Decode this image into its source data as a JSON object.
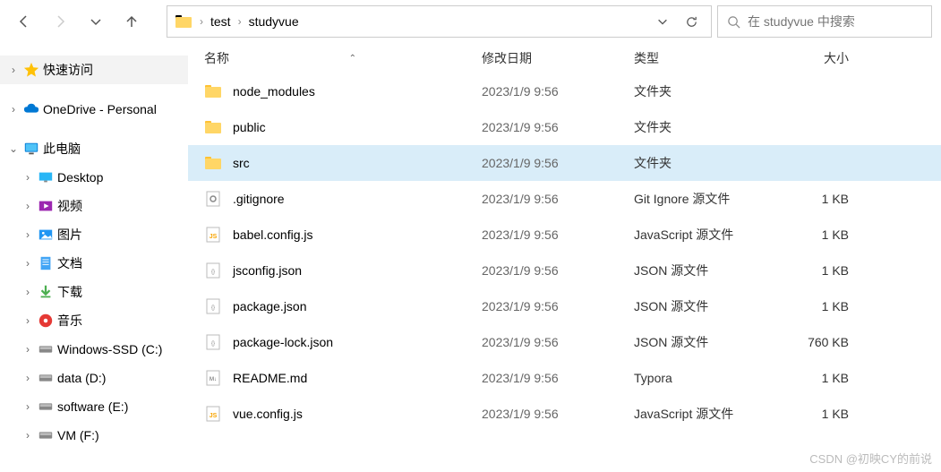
{
  "nav": {},
  "breadcrumb": {
    "parts": [
      "test",
      "studyvue"
    ]
  },
  "search": {
    "placeholder": "在 studyvue 中搜索"
  },
  "sidebar": {
    "quick_access": "快速访问",
    "onedrive": "OneDrive - Personal",
    "this_pc": "此电脑",
    "desktop": "Desktop",
    "videos": "视频",
    "pictures": "图片",
    "documents": "文档",
    "downloads": "下载",
    "music": "音乐",
    "win_ssd": "Windows-SSD (C:)",
    "data": "data (D:)",
    "software": "software (E:)",
    "vm": "VM (F:)"
  },
  "columns": {
    "name": "名称",
    "date": "修改日期",
    "type": "类型",
    "size": "大小"
  },
  "files": [
    {
      "name": "node_modules",
      "date": "2023/1/9 9:56",
      "type": "文件夹",
      "size": "",
      "icon": "folder",
      "selected": false
    },
    {
      "name": "public",
      "date": "2023/1/9 9:56",
      "type": "文件夹",
      "size": "",
      "icon": "folder",
      "selected": false
    },
    {
      "name": "src",
      "date": "2023/1/9 9:56",
      "type": "文件夹",
      "size": "",
      "icon": "folder",
      "selected": true
    },
    {
      "name": ".gitignore",
      "date": "2023/1/9 9:56",
      "type": "Git Ignore 源文件",
      "size": "1 KB",
      "icon": "gear",
      "selected": false
    },
    {
      "name": "babel.config.js",
      "date": "2023/1/9 9:56",
      "type": "JavaScript 源文件",
      "size": "1 KB",
      "icon": "js",
      "selected": false
    },
    {
      "name": "jsconfig.json",
      "date": "2023/1/9 9:56",
      "type": "JSON 源文件",
      "size": "1 KB",
      "icon": "json",
      "selected": false
    },
    {
      "name": "package.json",
      "date": "2023/1/9 9:56",
      "type": "JSON 源文件",
      "size": "1 KB",
      "icon": "json",
      "selected": false
    },
    {
      "name": "package-lock.json",
      "date": "2023/1/9 9:56",
      "type": "JSON 源文件",
      "size": "760 KB",
      "icon": "json",
      "selected": false
    },
    {
      "name": "README.md",
      "date": "2023/1/9 9:56",
      "type": "Typora",
      "size": "1 KB",
      "icon": "md",
      "selected": false
    },
    {
      "name": "vue.config.js",
      "date": "2023/1/9 9:56",
      "type": "JavaScript 源文件",
      "size": "1 KB",
      "icon": "js",
      "selected": false
    }
  ],
  "watermark": "CSDN @初映CY的前说"
}
